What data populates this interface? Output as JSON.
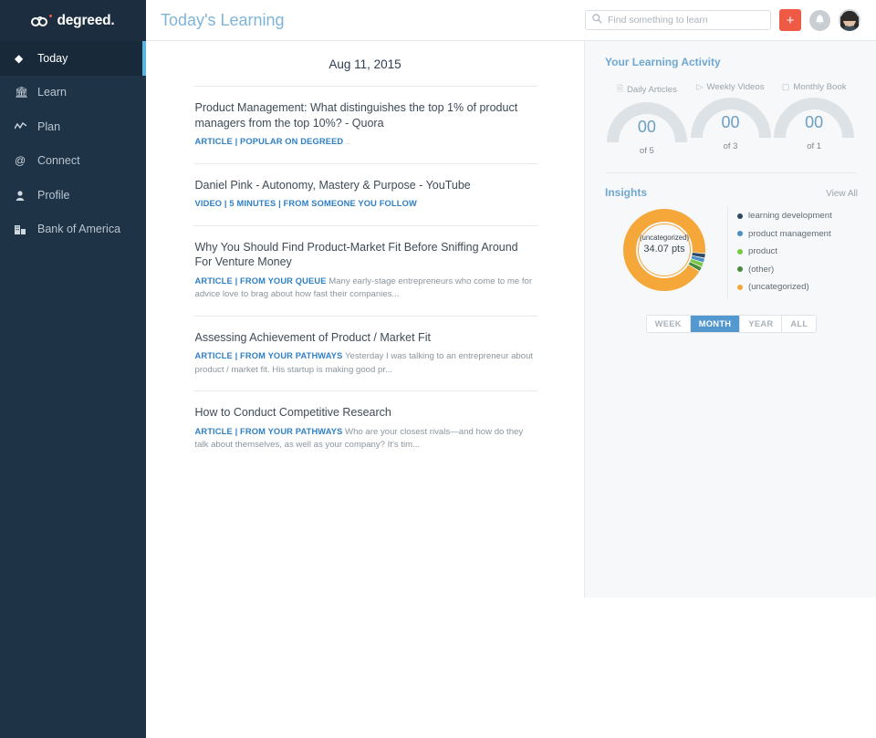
{
  "brand": {
    "name": "degreed.",
    "logo_icon": "glasses-icon",
    "accent": "#f05a45"
  },
  "sidebar": {
    "items": [
      {
        "label": "Today",
        "icon": "diamond-icon",
        "active": true
      },
      {
        "label": "Learn",
        "icon": "bank-icon",
        "active": false
      },
      {
        "label": "Plan",
        "icon": "line-chart-icon",
        "active": false
      },
      {
        "label": "Connect",
        "icon": "at-sign-icon",
        "active": false
      },
      {
        "label": "Profile",
        "icon": "person-icon",
        "active": false
      },
      {
        "label": "Bank of America",
        "icon": "building-icon",
        "active": false
      }
    ]
  },
  "topbar": {
    "title": "Today's Learning",
    "search": {
      "placeholder": "Find something to learn",
      "value": "",
      "icon": "search-icon"
    },
    "add_button": {
      "label": "+",
      "icon": "plus-icon",
      "color": "#ef5a45"
    },
    "notifications": {
      "icon": "bell-icon"
    },
    "avatar": {
      "icon": "user-avatar"
    }
  },
  "feed": {
    "date": "Aug 11, 2015",
    "items": [
      {
        "title": "Product Management: What distinguishes the top 1% of product managers from the top 10%? - Quora",
        "tags": "ARTICLE | POPULAR ON DEGREED",
        "snippet": "",
        "ellipsis": ".."
      },
      {
        "title": "Daniel Pink - Autonomy, Mastery & Purpose - YouTube",
        "tags": "VIDEO | 5 MINUTES | FROM SOMEONE YOU FOLLOW",
        "snippet": "",
        "ellipsis": ""
      },
      {
        "title": "Why You Should Find Product-Market Fit Before Sniffing Around For Venture Money",
        "tags": "ARTICLE | FROM YOUR QUEUE",
        "snippet": "Many early-stage entrepreneurs who come to me for advice love to brag about how fast their companies...",
        "ellipsis": ""
      },
      {
        "title": "Assessing Achievement of Product / Market Fit",
        "tags": "ARTICLE | FROM YOUR PATHWAYS",
        "snippet": "Yesterday I was talking to an entrepreneur about product / market fit. His startup is making good pr...",
        "ellipsis": ""
      },
      {
        "title": "How to Conduct Competitive Research",
        "tags": "ARTICLE | FROM YOUR PATHWAYS",
        "snippet": "Who are your closest rivals—and how do they talk about themselves, as well as your company? It's tim...",
        "ellipsis": ""
      }
    ]
  },
  "activity": {
    "title": "Your Learning Activity",
    "gauges": [
      {
        "label": "Daily Articles",
        "icon": "document-icon",
        "value": "00",
        "goal": "of 5"
      },
      {
        "label": "Weekly Videos",
        "icon": "video-icon",
        "value": "00",
        "goal": "of 3"
      },
      {
        "label": "Monthly Book",
        "icon": "book-icon",
        "value": "00",
        "goal": "of 1"
      }
    ]
  },
  "insights": {
    "title": "Insights",
    "view_all": "View All",
    "center_category": "(uncategorized)",
    "center_points": "34.07 pts",
    "periods": [
      {
        "label": "WEEK",
        "active": false
      },
      {
        "label": "MONTH",
        "active": true
      },
      {
        "label": "YEAR",
        "active": false
      },
      {
        "label": "ALL",
        "active": false
      }
    ]
  },
  "chart_data": {
    "type": "pie",
    "title": "Insights",
    "subtitle": "34.07 pts",
    "center_label": "(uncategorized)",
    "unit": "pts",
    "legend_position": "right",
    "categories": [
      "learning development",
      "product management",
      "product",
      "(other)",
      "(uncategorized)"
    ],
    "values": [
      0.62,
      0.62,
      0.62,
      0.62,
      31.59
    ],
    "percentages": [
      1.8,
      1.8,
      1.8,
      1.8,
      92.8
    ],
    "colors": [
      "#2c4a63",
      "#4a90c4",
      "#7ac943",
      "#4a8a3c",
      "#f5a839"
    ],
    "donut": true,
    "period_selected": "MONTH"
  }
}
